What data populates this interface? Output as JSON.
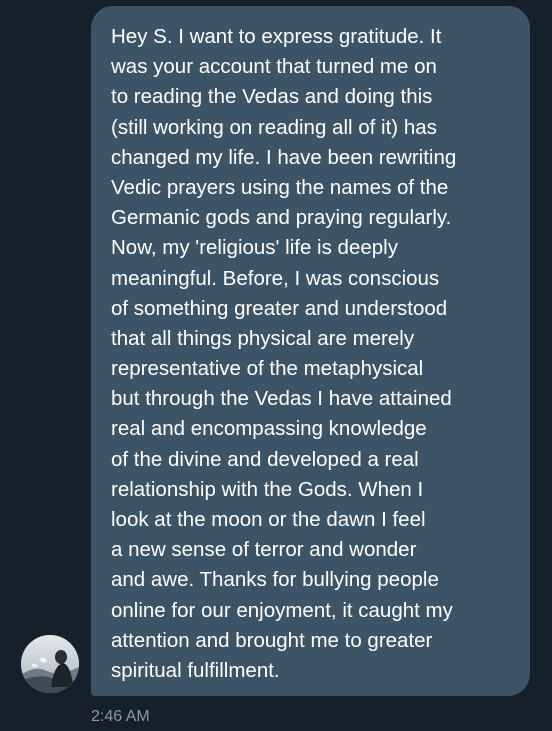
{
  "conversation": {
    "message": {
      "lines": [
        "Hey S. I want to express gratitude. It",
        "was your account that turned me on",
        "to reading the Vedas and doing this",
        "(still working on reading all of it) has",
        "changed my life. I have been rewriting",
        "Vedic prayers using the names of the",
        "Germanic gods and praying regularly.",
        "Now, my 'religious' life is deeply",
        "meaningful. Before, I was conscious",
        "of something greater and understood",
        "that all things physical are merely",
        "representative of the metaphysical",
        "but through the Vedas I have attained",
        "real and encompassing knowledge",
        "of the divine and developed a real",
        "relationship with the Gods. When I",
        "look at the moon or the dawn I feel",
        "a new sense of terror and wonder",
        "and awe. Thanks for bullying people",
        "online for our enjoyment, it caught my",
        "attention and brought me to greater",
        "spiritual fulfillment."
      ],
      "timestamp": "2:46 AM"
    },
    "sender": {
      "avatar_icon": "user-avatar-photo"
    }
  },
  "colors": {
    "background": "#15202b",
    "bubble": "#3d5466",
    "message_text": "#ffffff",
    "timestamp": "#8899a6"
  }
}
